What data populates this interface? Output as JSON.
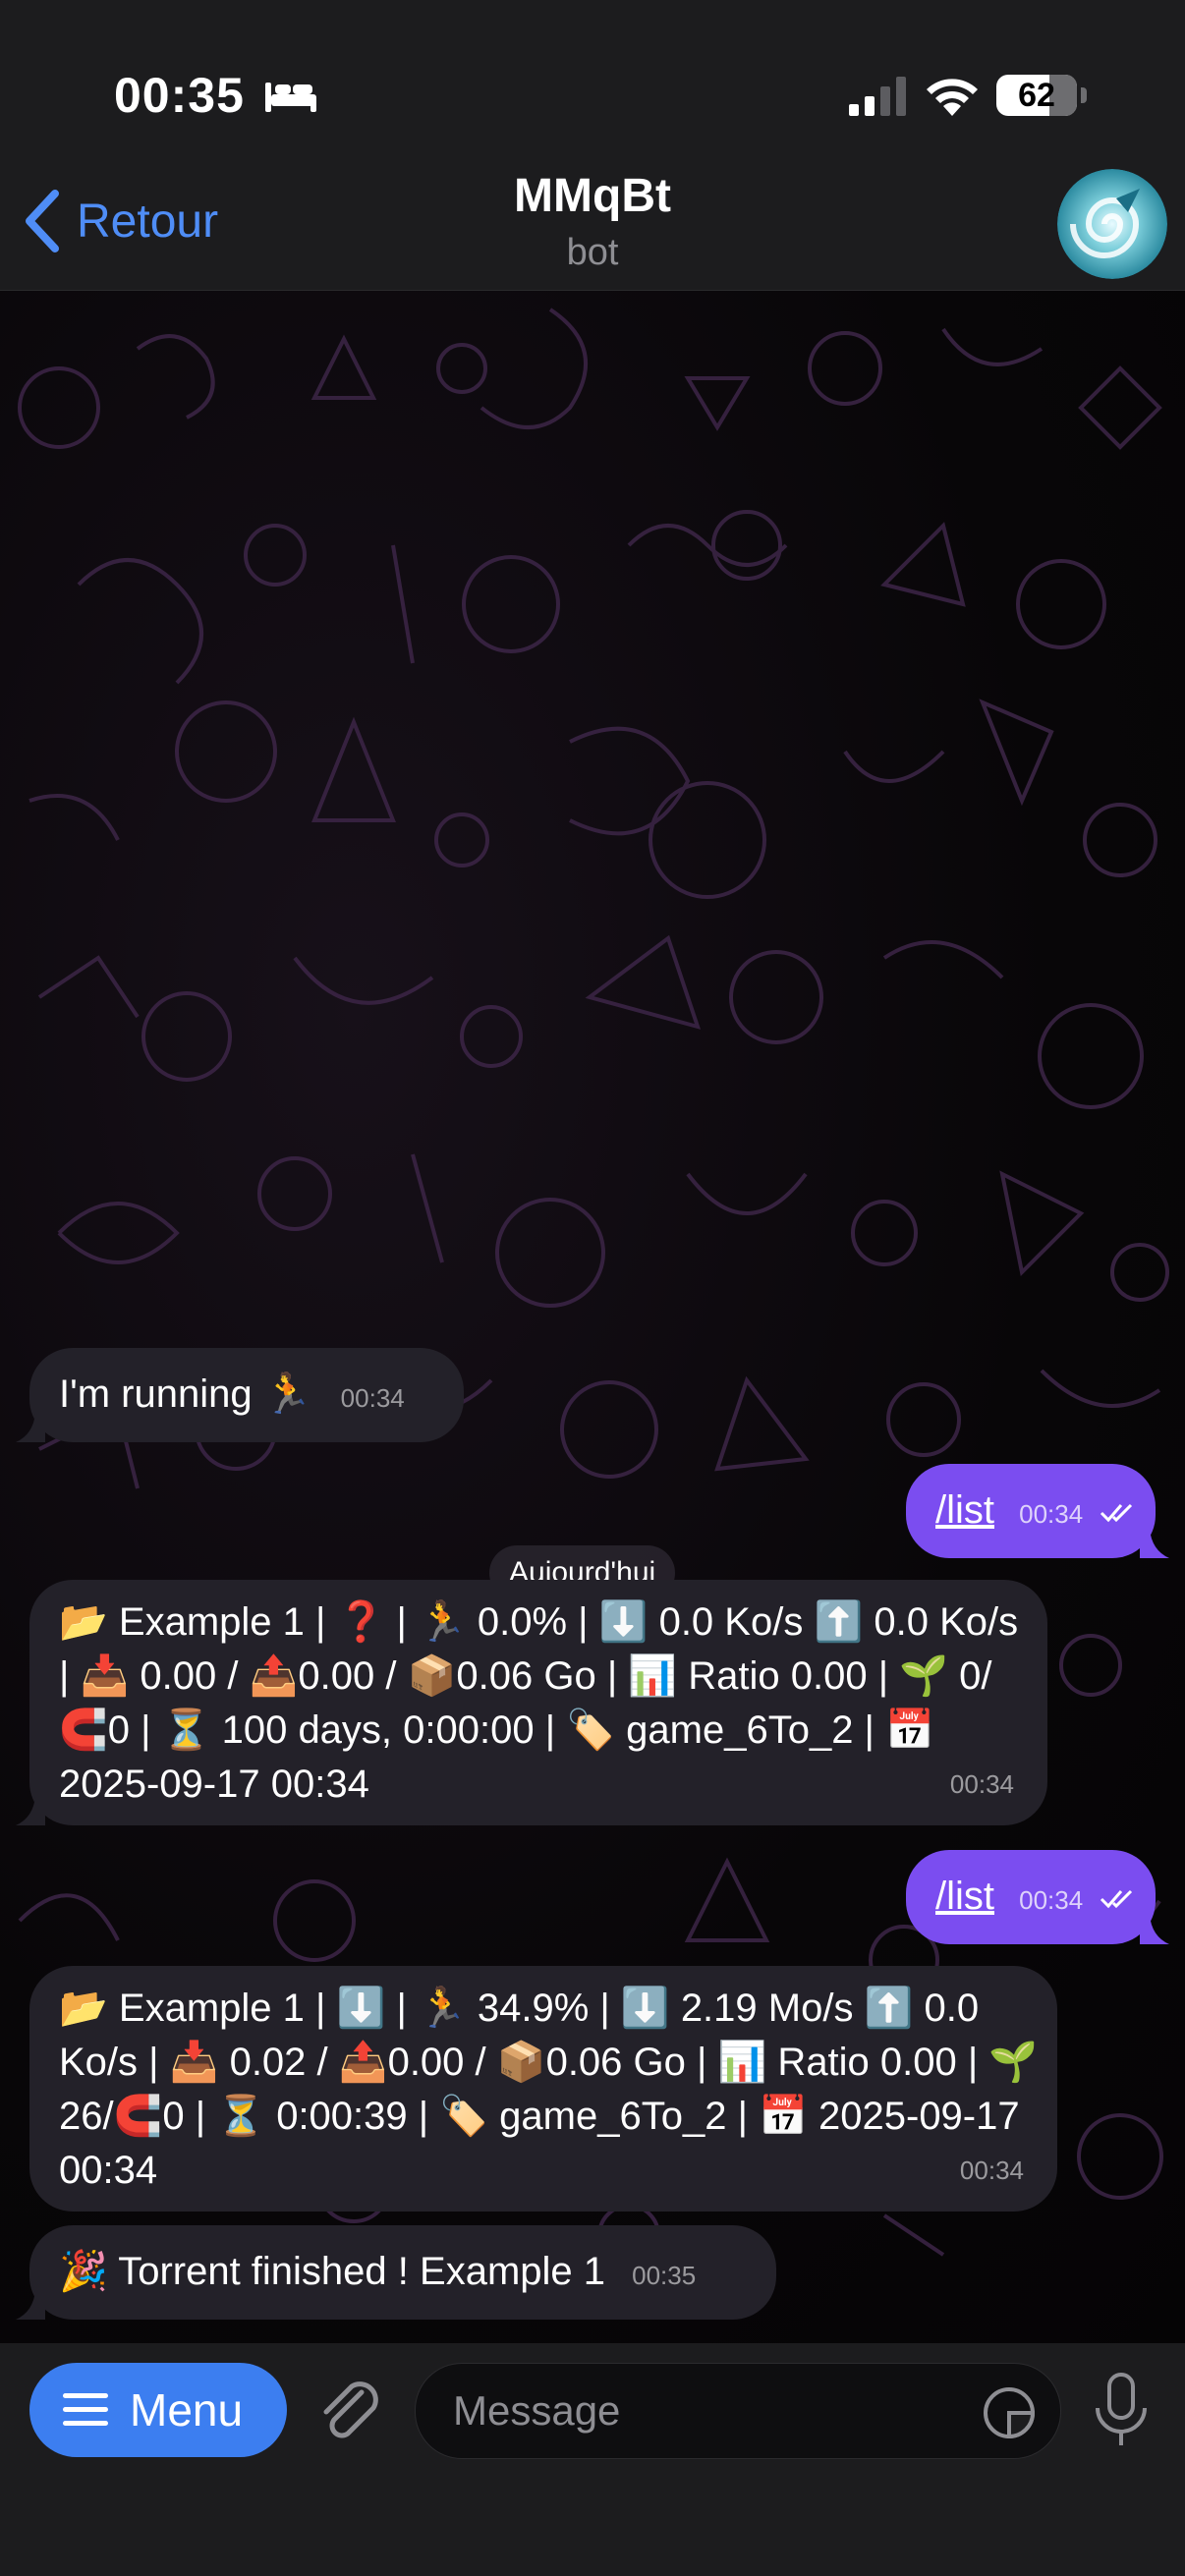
{
  "status_bar": {
    "time": "00:35",
    "battery": "62",
    "icons": [
      "bed-icon",
      "signal-icon",
      "wifi-icon",
      "battery-icon"
    ]
  },
  "header": {
    "back_label": "Retour",
    "title": "MMqBt",
    "subtitle": "bot"
  },
  "chat": {
    "date_separator": "Aujourd'hui",
    "messages": [
      {
        "direction": "in",
        "text": "I'm running 🏃",
        "time": "00:34"
      },
      {
        "direction": "out",
        "text": "/list",
        "time": "00:34",
        "status": "read"
      },
      {
        "direction": "in",
        "text": "📂 Example 1 | ❓ | 🏃 0.0% | ⬇️ 0.0 Ko/s ⬆️ 0.0 Ko/s | 📥 0.00 / 📤0.00 / 📦0.06 Go | 📊 Ratio 0.00 | 🌱 0/🧲0 | ⏳ 100 days, 0:00:00 | 🏷️ game_6To_2 | 📅 2025-09-17 00:34",
        "time": "00:34"
      },
      {
        "direction": "out",
        "text": "/list",
        "time": "00:34",
        "status": "read"
      },
      {
        "direction": "in",
        "text": "📂 Example 1 | ⬇️ | 🏃 34.9% | ⬇️ 2.19 Mo/s ⬆️ 0.0 Ko/s | 📥 0.02 / 📤0.00 / 📦0.06 Go | 📊 Ratio 0.00 | 🌱 26/🧲0 | ⏳ 0:00:39 | 🏷️ game_6To_2 | 📅 2025-09-17 00:34",
        "time": "00:34"
      },
      {
        "direction": "in",
        "text": "🎉 Torrent finished ! Example 1",
        "time": "00:35"
      }
    ]
  },
  "input_bar": {
    "menu_label": "Menu",
    "placeholder": "Message"
  },
  "colors": {
    "accent": "#4f8df6",
    "outgoing_bubble": "#7b4df0",
    "incoming_bubble": "#232129",
    "menu_button": "#3c7ef0"
  }
}
